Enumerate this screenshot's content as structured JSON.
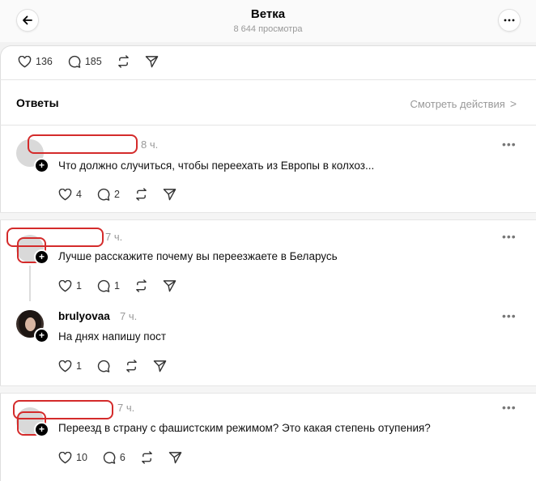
{
  "header": {
    "title": "Ветка",
    "subtitle": "8 644 просмотра"
  },
  "post_actions": {
    "likes": "136",
    "comments": "185"
  },
  "answers": {
    "title": "Ответы",
    "view_actions": "Смотреть действия",
    "view_actions_chevron": ">"
  },
  "comments": [
    {
      "time": "8 ч.",
      "text": "Что должно случиться, чтобы переехать из Европы в колхоз...",
      "likes": "4",
      "replies": "2"
    },
    {
      "time": "7 ч.",
      "text": "Лучше расскажите почему вы переезжаете в Беларусь",
      "likes": "1",
      "replies": "1"
    },
    {
      "username": "brulyovaa",
      "time": "7 ч.",
      "text": "На днях напишу пост",
      "likes": "1",
      "replies": ""
    },
    {
      "time": "7 ч.",
      "text": "Переезд в страну с фашистским режимом? Это какая степень отупения?",
      "likes": "10",
      "replies": "6"
    }
  ],
  "icons": {
    "back": "arrow-left-icon",
    "more": "more-icon",
    "like": "heart-icon",
    "reply": "comment-icon",
    "repost": "repost-icon",
    "share": "send-icon",
    "follow": "plus-icon"
  },
  "colors": {
    "redaction": "#d42b2b",
    "muted": "#999999"
  }
}
